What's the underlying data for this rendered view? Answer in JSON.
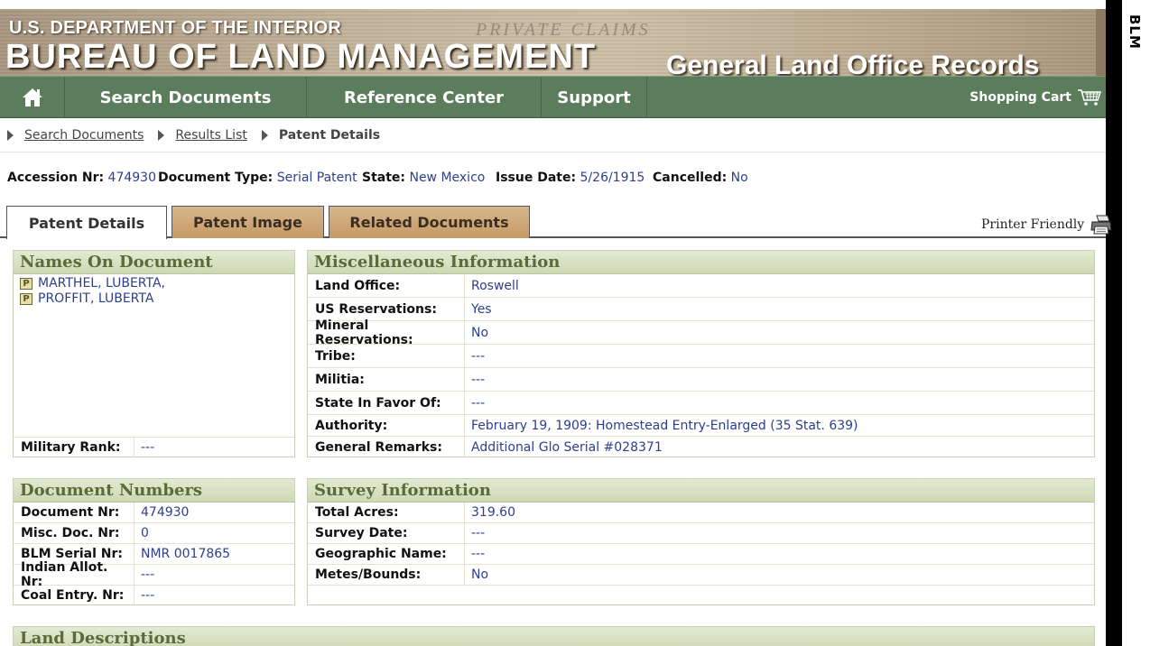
{
  "banner": {
    "subtitle": "U.S. DEPARTMENT OF THE INTERIOR",
    "title": "BUREAU OF LAND MANAGEMENT",
    "watermark": "PRIVATE CLAIMS",
    "site_name": "General Land Office Records"
  },
  "side_strip": "BLM",
  "nav": {
    "home_icon": "home-icon",
    "items": [
      "Search Documents",
      "Reference Center",
      "Support"
    ],
    "cart_label": "Shopping Cart",
    "cart_icon": "shopping-cart-icon"
  },
  "breadcrumb": [
    "Search Documents",
    "Results List",
    "Patent Details"
  ],
  "summary": {
    "accession_label": "Accession Nr:",
    "accession": "474930",
    "doctype_label": "Document Type:",
    "doctype": "Serial Patent",
    "state_label": "State:",
    "state": "New Mexico",
    "issue_label": "Issue Date:",
    "issue_date": "5/26/1915",
    "cancelled_label": "Cancelled:",
    "cancelled": "No"
  },
  "tabs": [
    "Patent Details",
    "Patent Image",
    "Related Documents"
  ],
  "printer_friendly": "Printer Friendly",
  "names_panel": {
    "title": "Names On Document",
    "names": [
      "MARTHEL, LUBERTA,",
      "PROFFIT, LUBERTA"
    ],
    "badge": "P",
    "military_rank_label": "Military Rank:",
    "military_rank": "---"
  },
  "misc_panel": {
    "title": "Miscellaneous Information",
    "rows": [
      {
        "label": "Land Office:",
        "value": "Roswell"
      },
      {
        "label": "US Reservations:",
        "value": "Yes"
      },
      {
        "label": "Mineral Reservations:",
        "value": "No"
      },
      {
        "label": "Tribe:",
        "value": "---"
      },
      {
        "label": "Militia:",
        "value": "---"
      },
      {
        "label": "State In Favor Of:",
        "value": "---"
      },
      {
        "label": "Authority:",
        "value": "February 19, 1909: Homestead Entry-Enlarged (35 Stat. 639)"
      },
      {
        "label": "General Remarks:",
        "value": "Additional Glo Serial #028371"
      }
    ]
  },
  "docnum_panel": {
    "title": "Document Numbers",
    "rows": [
      {
        "label": "Document Nr:",
        "value": "474930"
      },
      {
        "label": "Misc. Doc. Nr:",
        "value": "0"
      },
      {
        "label": "BLM Serial Nr:",
        "value": "NMR 0017865"
      },
      {
        "label": "Indian Allot. Nr:",
        "value": "---"
      },
      {
        "label": "Coal Entry. Nr:",
        "value": "---"
      }
    ]
  },
  "survey_panel": {
    "title": "Survey Information",
    "rows": [
      {
        "label": "Total Acres:",
        "value": "319.60"
      },
      {
        "label": "Survey Date:",
        "value": "---"
      },
      {
        "label": "Geographic Name:",
        "value": "---"
      },
      {
        "label": "Metes/Bounds:",
        "value": "No"
      }
    ]
  },
  "land_panel": {
    "title": "Land Descriptions"
  }
}
